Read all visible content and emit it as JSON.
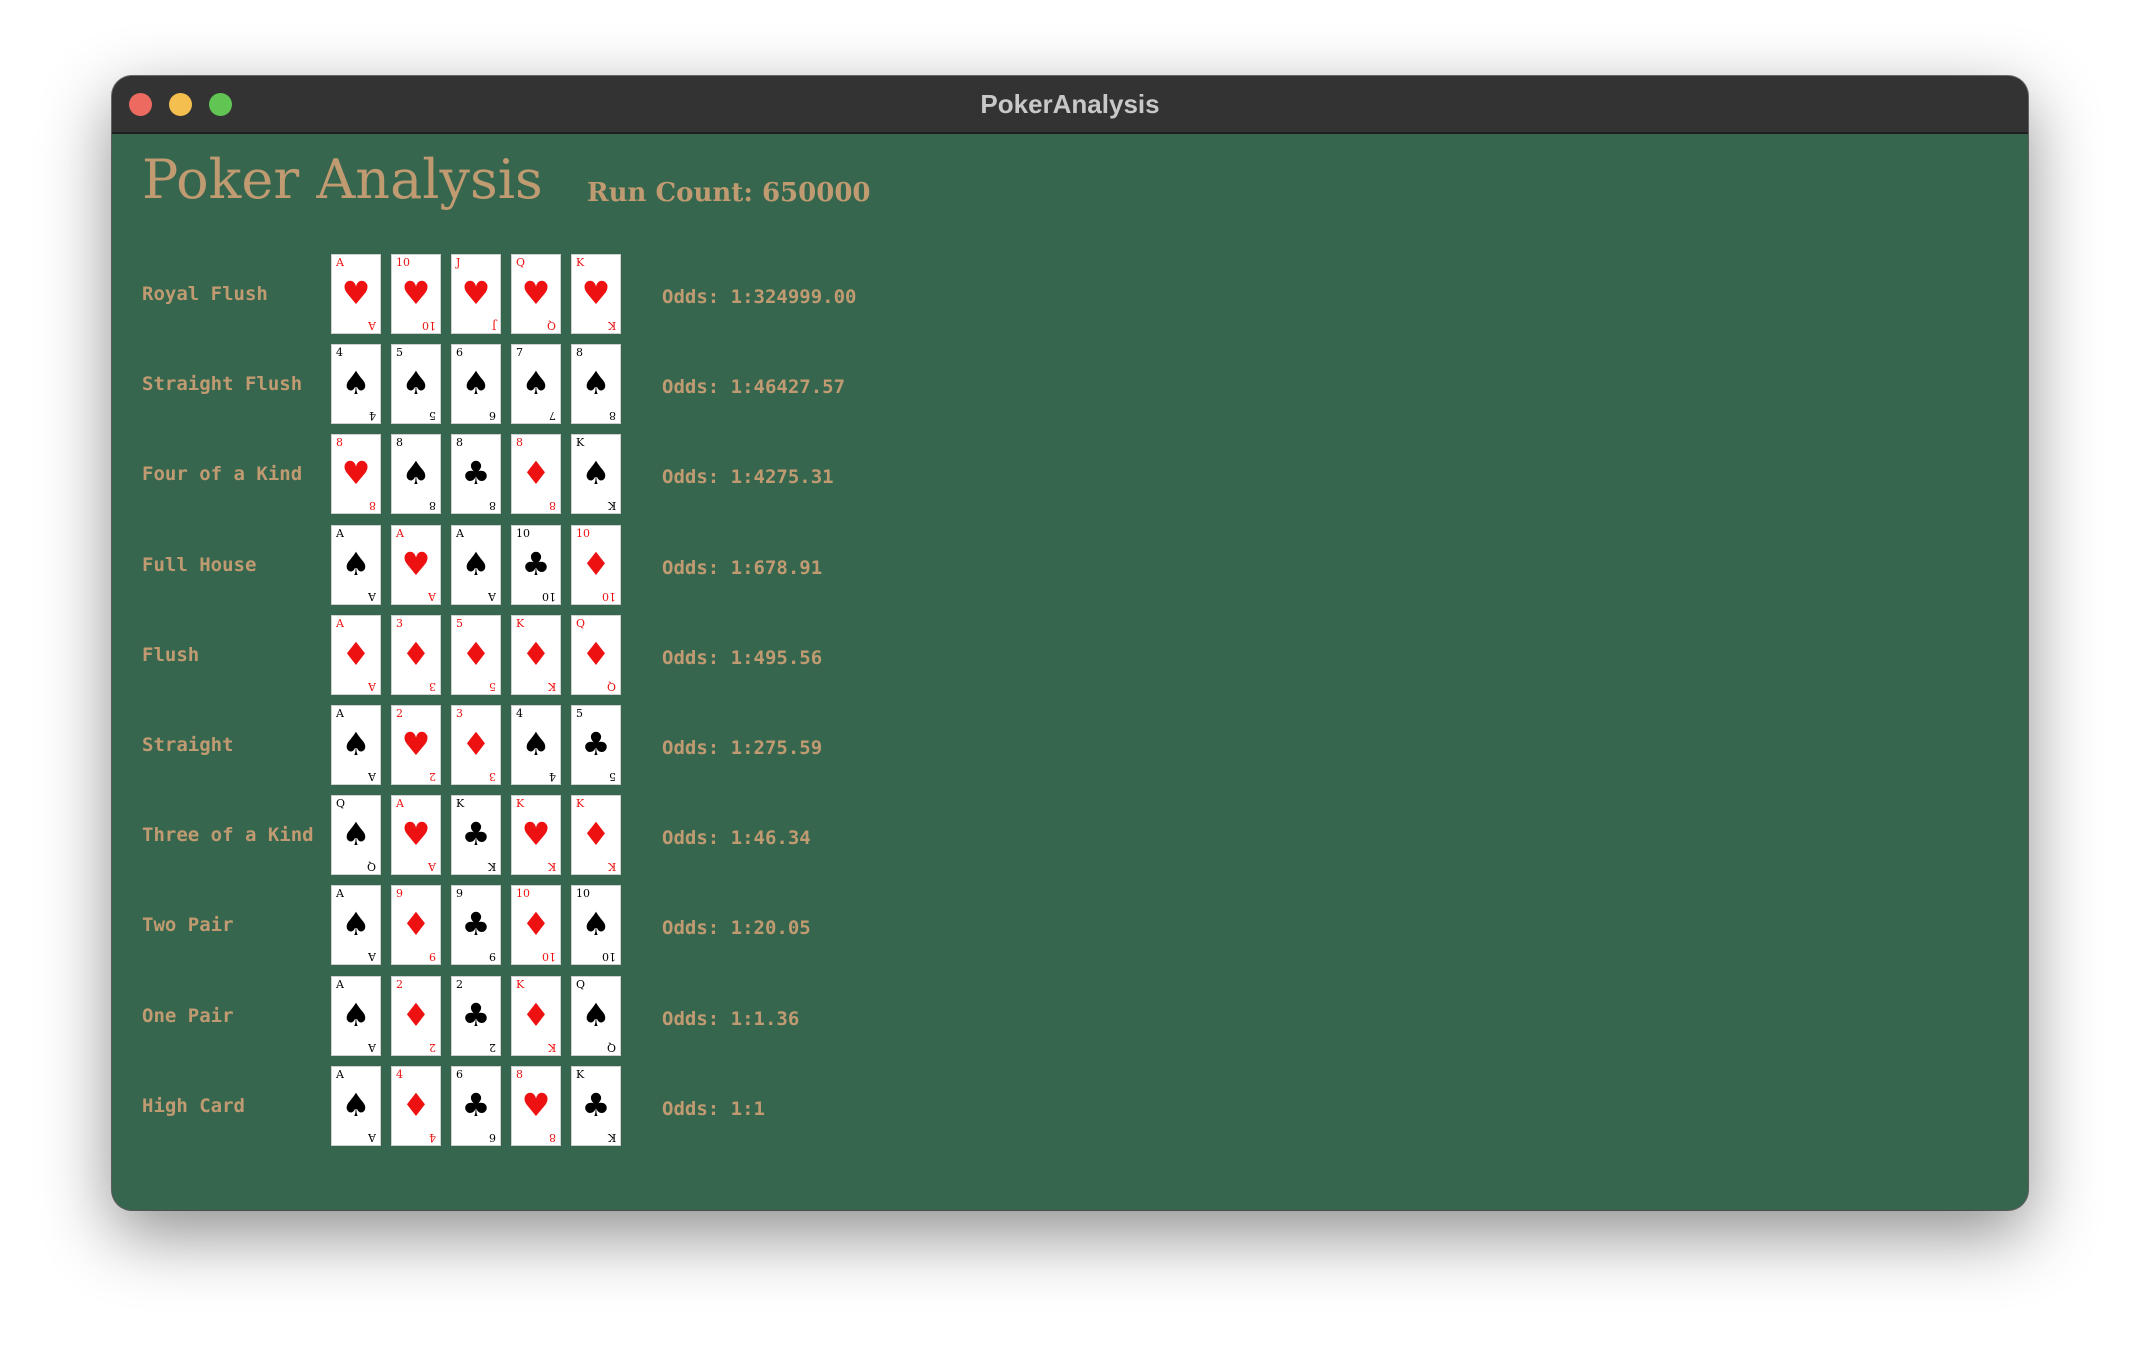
{
  "window": {
    "title": "PokerAnalysis"
  },
  "colors": {
    "felt": "#37664f",
    "accent": "#c09b71",
    "red_suit": "#ee1111",
    "black_suit": "#000000",
    "titlebar": "#333333"
  },
  "app": {
    "title": "Poker Analysis",
    "run_count_label": "Run Count: 650000"
  },
  "suits": {
    "hearts": "♥",
    "diamonds": "♦",
    "spades": "♠",
    "clubs": "♣"
  },
  "hands": [
    {
      "name": "Royal Flush",
      "odds": "Odds: 1:324999.00",
      "cards": [
        {
          "rank": "A",
          "suit": "hearts"
        },
        {
          "rank": "10",
          "suit": "hearts"
        },
        {
          "rank": "J",
          "suit": "hearts"
        },
        {
          "rank": "Q",
          "suit": "hearts"
        },
        {
          "rank": "K",
          "suit": "hearts"
        }
      ]
    },
    {
      "name": "Straight Flush",
      "odds": "Odds: 1:46427.57",
      "cards": [
        {
          "rank": "4",
          "suit": "spades"
        },
        {
          "rank": "5",
          "suit": "spades"
        },
        {
          "rank": "6",
          "suit": "spades"
        },
        {
          "rank": "7",
          "suit": "spades"
        },
        {
          "rank": "8",
          "suit": "spades"
        }
      ]
    },
    {
      "name": "Four of a Kind",
      "odds": "Odds: 1:4275.31",
      "cards": [
        {
          "rank": "8",
          "suit": "hearts"
        },
        {
          "rank": "8",
          "suit": "spades"
        },
        {
          "rank": "8",
          "suit": "clubs"
        },
        {
          "rank": "8",
          "suit": "diamonds"
        },
        {
          "rank": "K",
          "suit": "spades"
        }
      ]
    },
    {
      "name": "Full House",
      "odds": "Odds: 1:678.91",
      "cards": [
        {
          "rank": "A",
          "suit": "spades"
        },
        {
          "rank": "A",
          "suit": "hearts"
        },
        {
          "rank": "A",
          "suit": "spades"
        },
        {
          "rank": "10",
          "suit": "clubs"
        },
        {
          "rank": "10",
          "suit": "diamonds"
        }
      ]
    },
    {
      "name": "Flush",
      "odds": "Odds: 1:495.56",
      "cards": [
        {
          "rank": "A",
          "suit": "diamonds"
        },
        {
          "rank": "3",
          "suit": "diamonds"
        },
        {
          "rank": "5",
          "suit": "diamonds"
        },
        {
          "rank": "K",
          "suit": "diamonds"
        },
        {
          "rank": "Q",
          "suit": "diamonds"
        }
      ]
    },
    {
      "name": "Straight",
      "odds": "Odds: 1:275.59",
      "cards": [
        {
          "rank": "A",
          "suit": "spades"
        },
        {
          "rank": "2",
          "suit": "hearts"
        },
        {
          "rank": "3",
          "suit": "diamonds"
        },
        {
          "rank": "4",
          "suit": "spades"
        },
        {
          "rank": "5",
          "suit": "clubs"
        }
      ]
    },
    {
      "name": "Three of a Kind",
      "odds": "Odds: 1:46.34",
      "cards": [
        {
          "rank": "Q",
          "suit": "spades"
        },
        {
          "rank": "A",
          "suit": "hearts"
        },
        {
          "rank": "K",
          "suit": "clubs"
        },
        {
          "rank": "K",
          "suit": "hearts"
        },
        {
          "rank": "K",
          "suit": "diamonds"
        }
      ]
    },
    {
      "name": "Two Pair",
      "odds": "Odds: 1:20.05",
      "cards": [
        {
          "rank": "A",
          "suit": "spades"
        },
        {
          "rank": "9",
          "suit": "diamonds"
        },
        {
          "rank": "9",
          "suit": "clubs"
        },
        {
          "rank": "10",
          "suit": "diamonds"
        },
        {
          "rank": "10",
          "suit": "spades"
        }
      ]
    },
    {
      "name": "One Pair",
      "odds": "Odds: 1:1.36",
      "cards": [
        {
          "rank": "A",
          "suit": "spades"
        },
        {
          "rank": "2",
          "suit": "diamonds"
        },
        {
          "rank": "2",
          "suit": "clubs"
        },
        {
          "rank": "K",
          "suit": "diamonds"
        },
        {
          "rank": "Q",
          "suit": "spades"
        }
      ]
    },
    {
      "name": "High Card",
      "odds": "Odds: 1:1",
      "cards": [
        {
          "rank": "A",
          "suit": "spades"
        },
        {
          "rank": "4",
          "suit": "diamonds"
        },
        {
          "rank": "6",
          "suit": "clubs"
        },
        {
          "rank": "8",
          "suit": "hearts"
        },
        {
          "rank": "K",
          "suit": "clubs"
        }
      ]
    }
  ]
}
